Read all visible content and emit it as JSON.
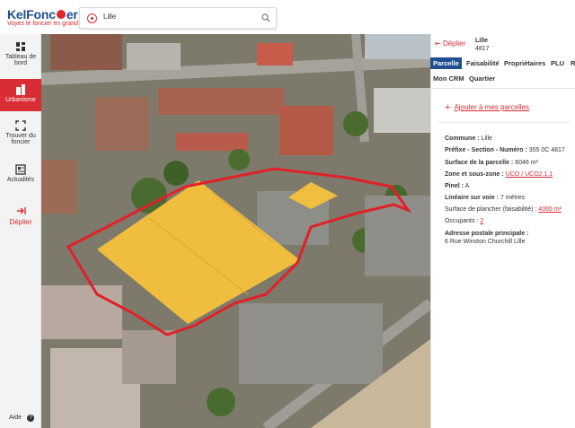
{
  "logo": {
    "brand_part1": "KelFonc",
    "brand_part2": "er",
    "tagline": "Voyez le foncier en grand"
  },
  "search": {
    "value": "Lille"
  },
  "nav": {
    "items": [
      {
        "label_l1": "Tableau de",
        "label_l2": "bord"
      },
      {
        "label_l1": "Urbanisme",
        "label_l2": ""
      },
      {
        "label_l1": "Trouver du",
        "label_l2": "foncier"
      },
      {
        "label_l1": "Actualités",
        "label_l2": ""
      }
    ],
    "deplier": "Déplier",
    "aide": "Aide"
  },
  "panel": {
    "deplier": "Déplier",
    "parcel_title": "Lille",
    "parcel_number": "4817",
    "tabs": [
      "Parcelle",
      "Faisabilité",
      "Propriétaires",
      "PLU",
      "R",
      "Mon CRM",
      "Quartier"
    ],
    "add_label": "Ajouter à mes parcelles",
    "commune_label": "Commune :",
    "commune_value": "Lille",
    "prefixe_label": "Préfixe - Section - Numéro :",
    "prefixe_value": "355 0C 4817",
    "surface_label": "Surface de la parcelle :",
    "surface_value": "6046 m²",
    "zone_label": "Zone et sous-zone :",
    "zone_value": "UCO / UCO2.1.1",
    "pinel_label": "Pinel :",
    "pinel_value": "A",
    "lineaire_label": "Linéaire sur voie :",
    "lineaire_value": "7 mètres",
    "plancher_label": "Surface de plancher (faisabilité) :",
    "plancher_value": "4065 m²",
    "occupants_label": "Occupants :",
    "occupants_value": "2",
    "adresse_label": "Adresse postale principale :",
    "adresse_value": "6 Rue Winston Churchill Lille"
  },
  "colors": {
    "accent": "#d92d34",
    "brand": "#1f4f91",
    "parcel_fill": "#f7c23c"
  }
}
